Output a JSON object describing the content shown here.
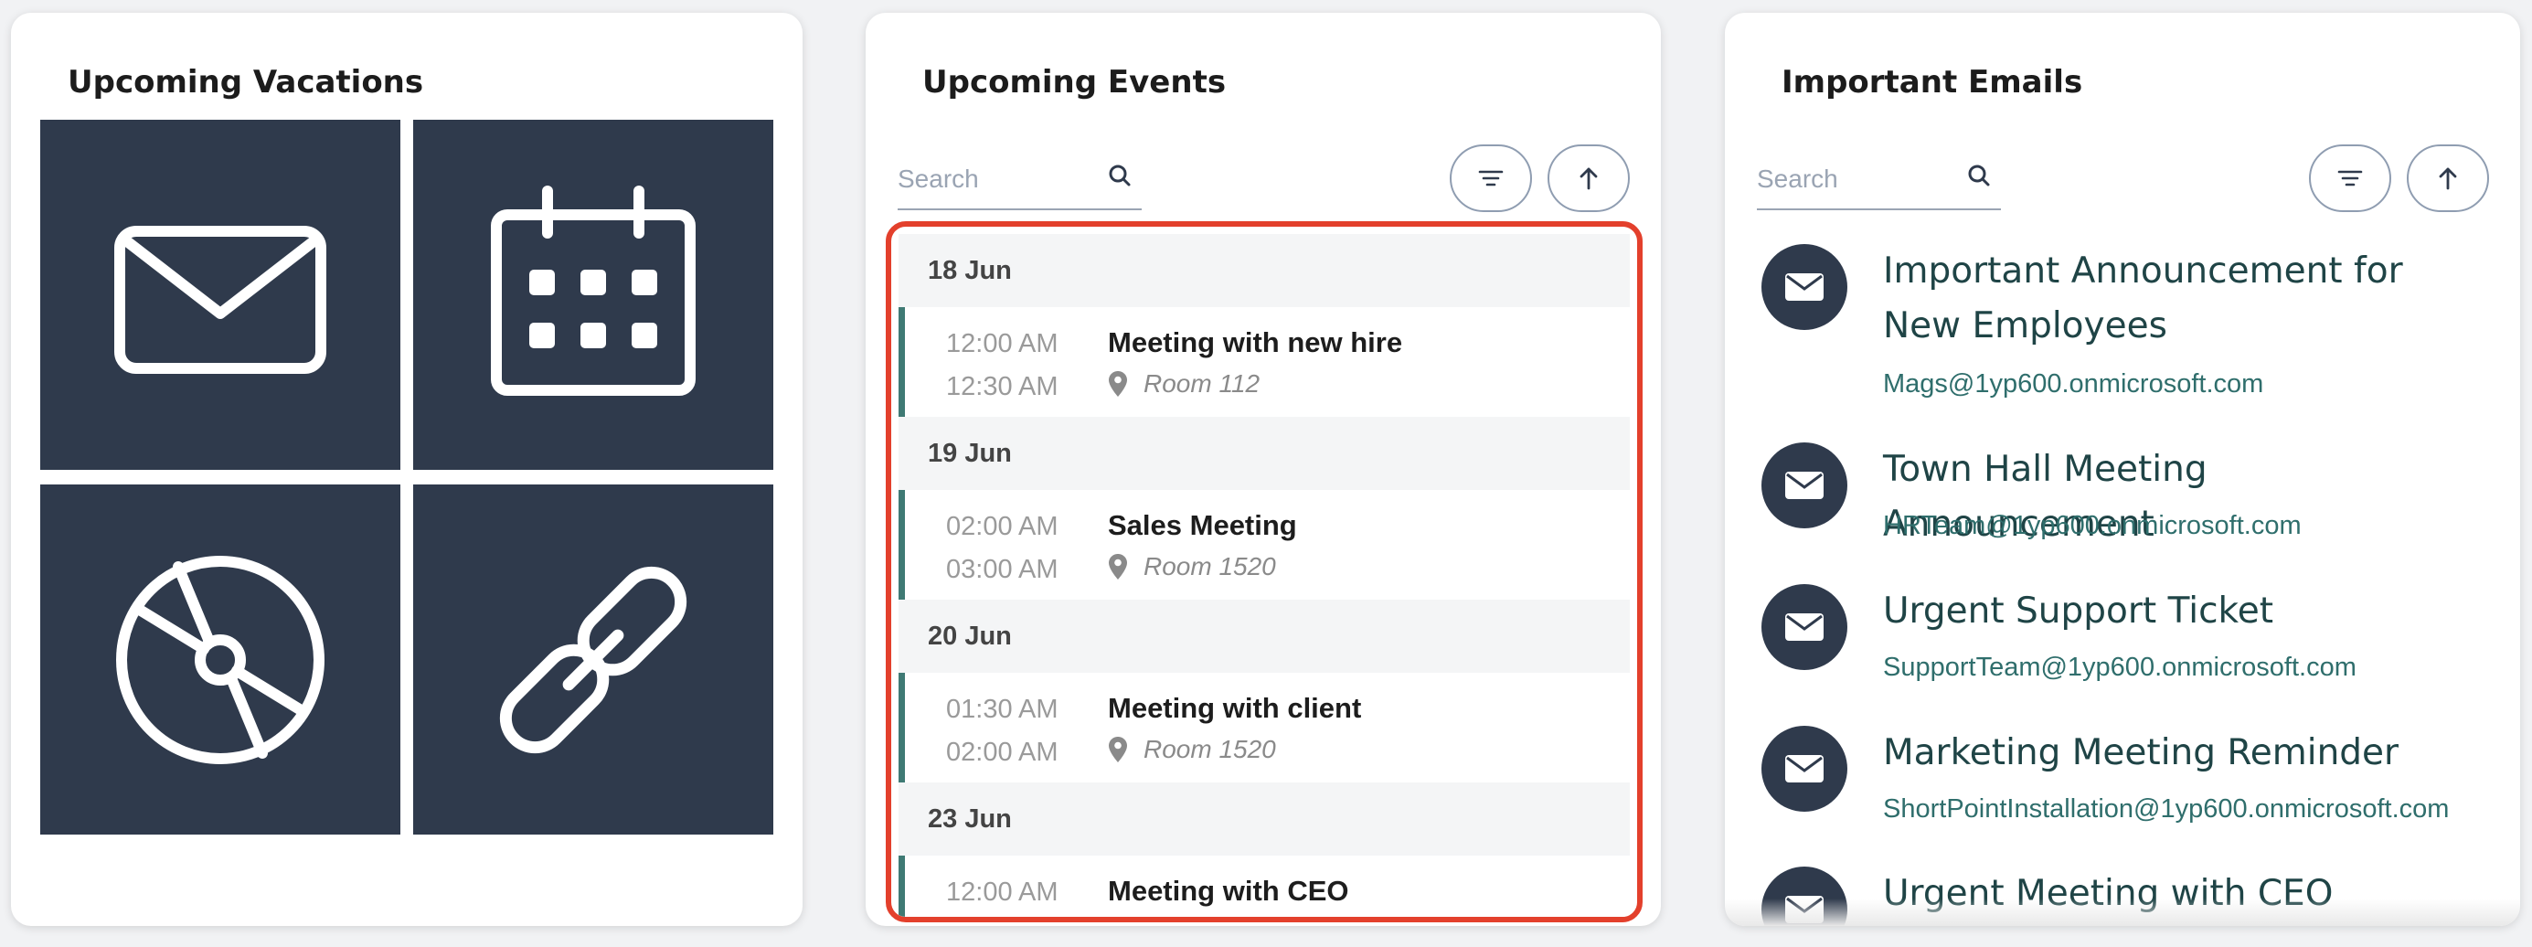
{
  "vacations": {
    "title": "Upcoming Vacations",
    "tiles": [
      "envelope-icon",
      "calendar-icon",
      "disc-icon",
      "link-icon"
    ]
  },
  "events": {
    "title": "Upcoming Events",
    "search_placeholder": "Search",
    "groups": [
      {
        "date": "18 Jun",
        "start": "12:00 AM",
        "end": "12:30 AM",
        "title": "Meeting with new hire",
        "location": "Room 112"
      },
      {
        "date": "19 Jun",
        "start": "02:00 AM",
        "end": "03:00 AM",
        "title": "Sales Meeting",
        "location": "Room 1520"
      },
      {
        "date": "20 Jun",
        "start": "01:30 AM",
        "end": "02:00 AM",
        "title": "Meeting with client",
        "location": "Room 1520"
      },
      {
        "date": "23 Jun",
        "start": "12:00 AM",
        "end": "",
        "title": "Meeting with CEO",
        "location": ""
      }
    ]
  },
  "emails": {
    "title": "Important Emails",
    "search_placeholder": "Search",
    "items": [
      {
        "subject": "Important Announcement for New Employees",
        "from": "Mags@1yp600.onmicrosoft.com"
      },
      {
        "subject": "Town Hall Meeting Announcement",
        "from": "HRTeam@1yp600.onmicrosoft.com"
      },
      {
        "subject": "Urgent Support Ticket",
        "from": "SupportTeam@1yp600.onmicrosoft.com"
      },
      {
        "subject": "Marketing Meeting Reminder",
        "from": "ShortPointInstallation@1yp600.onmicrosoft.com"
      },
      {
        "subject": "Urgent Meeting with CEO",
        "from": ""
      }
    ]
  },
  "colors": {
    "tile": "#2f3a4c",
    "accent_bar": "#3f7a74",
    "highlight_border": "#e3402c",
    "email_link": "#2f6e6c"
  }
}
